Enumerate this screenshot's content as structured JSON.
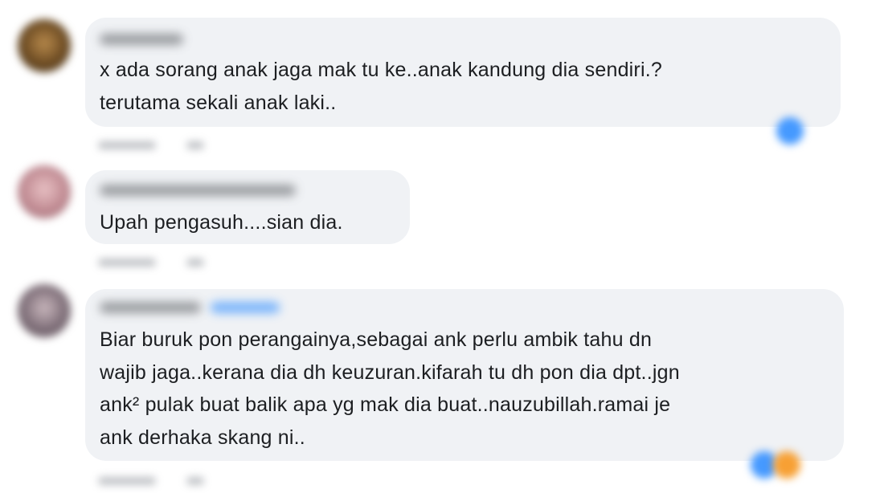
{
  "comments": [
    {
      "lines": [
        "x ada sorang anak jaga mak tu ke..anak kandung dia sendiri.?",
        "terutama sekali anak laki.."
      ]
    },
    {
      "lines": [
        "Upah pengasuh....sian dia."
      ]
    },
    {
      "lines": [
        "Biar buruk pon perangainya,sebagai ank perlu ambik tahu dn",
        "wajib jaga..kerana dia dh keuzuran.kifarah tu dh pon dia dpt..jgn",
        "ank² pulak buat balik apa yg mak dia buat..nauzubillah.ramai je",
        "ank derhaka skang ni.."
      ]
    }
  ],
  "colors": {
    "bubble": "#f0f2f5",
    "text": "#1c1e21",
    "like_reaction": "#4599ff",
    "haha_reaction": "#f7b125"
  }
}
